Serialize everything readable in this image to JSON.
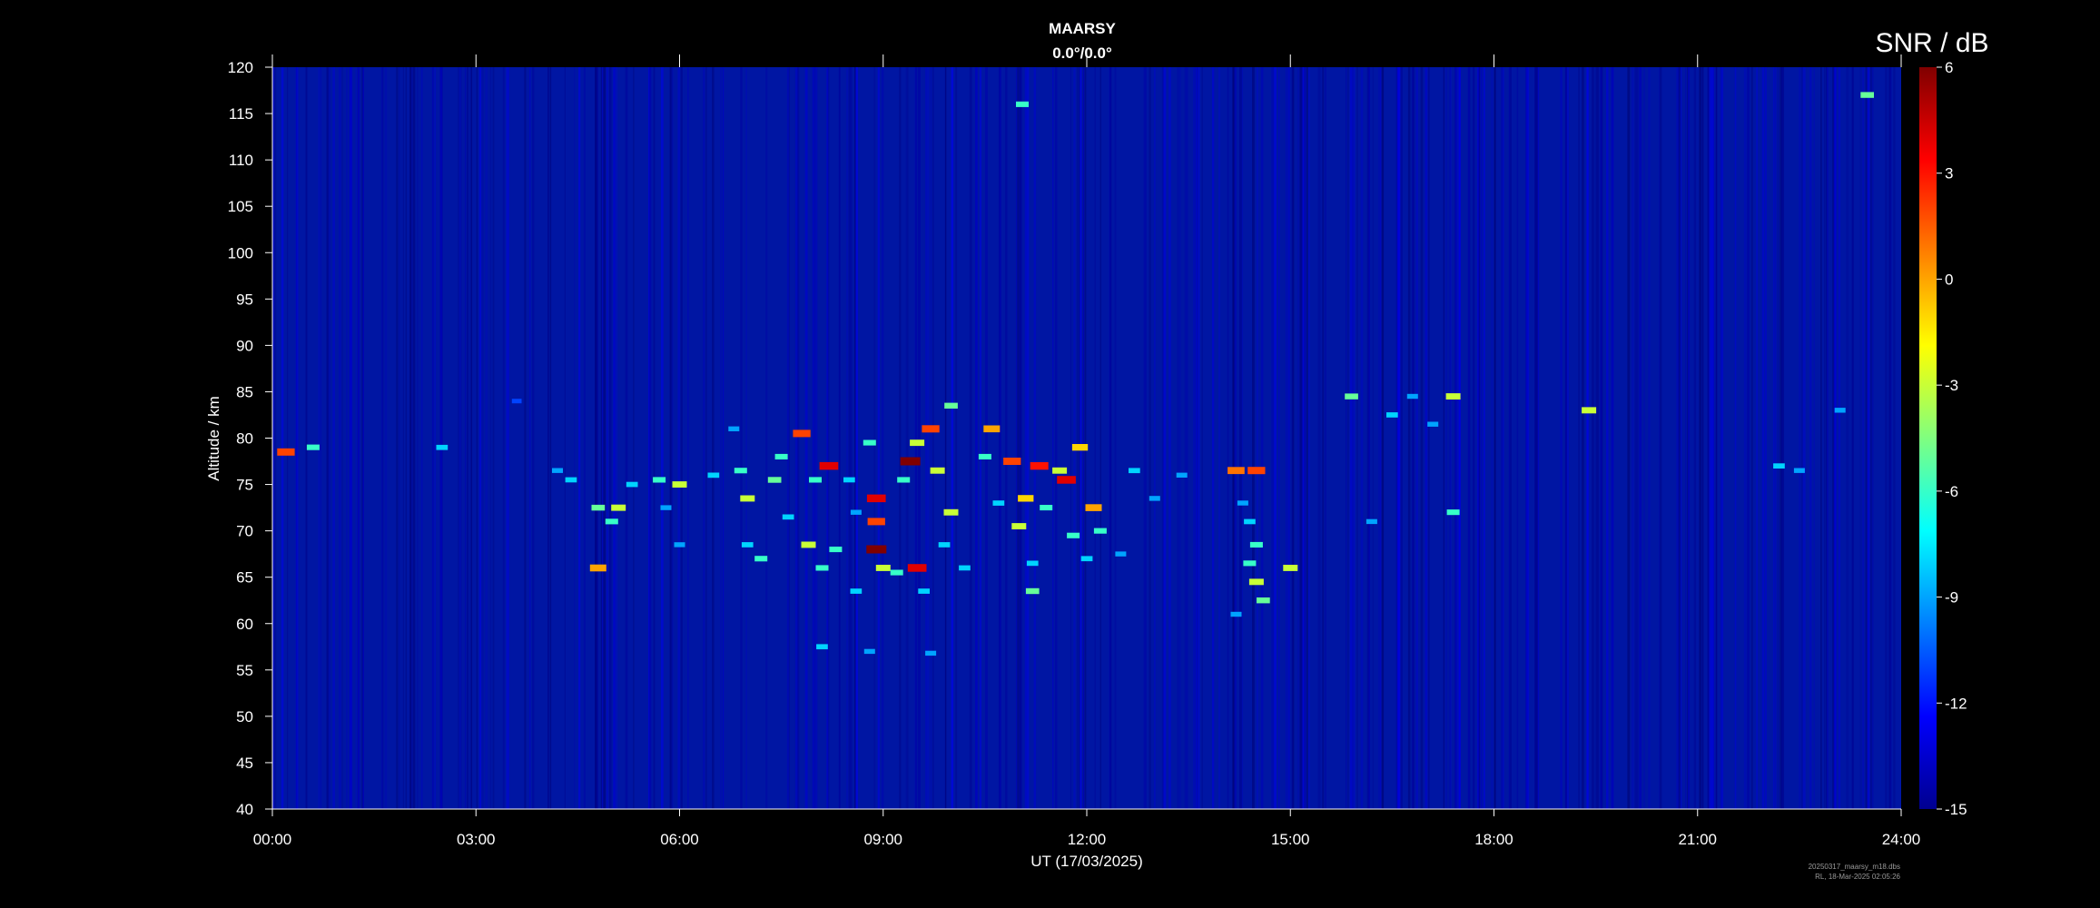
{
  "chart_data": {
    "type": "heatmap",
    "title": "MAARSY",
    "subtitle": "0.0°/0.0°",
    "xlabel": "UT (17/03/2025)",
    "ylabel": "Altitude / km",
    "colorbar_label": "SNR / dB",
    "x_unit": "hours UT",
    "xlim": [
      0,
      24
    ],
    "ylim": [
      40,
      120
    ],
    "x_ticks": [
      0,
      3,
      6,
      9,
      12,
      15,
      18,
      21,
      24
    ],
    "x_tick_labels": [
      "00:00",
      "03:00",
      "06:00",
      "09:00",
      "12:00",
      "15:00",
      "18:00",
      "21:00",
      "24:00"
    ],
    "y_ticks": [
      40,
      45,
      50,
      55,
      60,
      65,
      70,
      75,
      80,
      85,
      90,
      95,
      100,
      105,
      110,
      115,
      120
    ],
    "y_tick_labels": [
      "40",
      "45",
      "50",
      "55",
      "60",
      "65",
      "70",
      "75",
      "80",
      "85",
      "90",
      "95",
      "100",
      "105",
      "110",
      "115",
      "120"
    ],
    "colorbar_range": [
      -15,
      6
    ],
    "colorbar_ticks": [
      -15,
      -12,
      -9,
      -6,
      -3,
      0,
      3,
      6
    ],
    "colorbar_tick_labels": [
      "-15",
      "-12",
      "-9",
      "-6",
      "-3",
      "0",
      "3",
      "6"
    ],
    "colormap": "jet",
    "background_snr": -14,
    "echoes": [
      {
        "t": 0.2,
        "alt": 78.5,
        "snr": 2
      },
      {
        "t": 0.6,
        "alt": 79,
        "snr": -6
      },
      {
        "t": 2.5,
        "alt": 79,
        "snr": -8
      },
      {
        "t": 3.6,
        "alt": 84,
        "snr": -11
      },
      {
        "t": 4.2,
        "alt": 76.5,
        "snr": -9
      },
      {
        "t": 4.4,
        "alt": 75.5,
        "snr": -8
      },
      {
        "t": 4.8,
        "alt": 72.5,
        "snr": -5
      },
      {
        "t": 5.0,
        "alt": 71,
        "snr": -6
      },
      {
        "t": 5.1,
        "alt": 72.5,
        "snr": -3
      },
      {
        "t": 4.8,
        "alt": 66,
        "snr": 0
      },
      {
        "t": 5.3,
        "alt": 75,
        "snr": -8
      },
      {
        "t": 5.7,
        "alt": 75.5,
        "snr": -6
      },
      {
        "t": 6.0,
        "alt": 75,
        "snr": -3
      },
      {
        "t": 5.8,
        "alt": 72.5,
        "snr": -9
      },
      {
        "t": 6.0,
        "alt": 68.5,
        "snr": -9
      },
      {
        "t": 6.5,
        "alt": 76,
        "snr": -8
      },
      {
        "t": 6.8,
        "alt": 81,
        "snr": -9
      },
      {
        "t": 6.9,
        "alt": 76.5,
        "snr": -6
      },
      {
        "t": 7.0,
        "alt": 73.5,
        "snr": -3
      },
      {
        "t": 7.0,
        "alt": 68.5,
        "snr": -8
      },
      {
        "t": 7.2,
        "alt": 67,
        "snr": -6
      },
      {
        "t": 7.4,
        "alt": 75.5,
        "snr": -5
      },
      {
        "t": 7.5,
        "alt": 78,
        "snr": -6
      },
      {
        "t": 7.6,
        "alt": 71.5,
        "snr": -8
      },
      {
        "t": 7.8,
        "alt": 80.5,
        "snr": 2
      },
      {
        "t": 7.9,
        "alt": 68.5,
        "snr": -3
      },
      {
        "t": 8.0,
        "alt": 75.5,
        "snr": -6
      },
      {
        "t": 8.1,
        "alt": 66,
        "snr": -6
      },
      {
        "t": 8.2,
        "alt": 77,
        "snr": 4
      },
      {
        "t": 8.3,
        "alt": 68,
        "snr": -6
      },
      {
        "t": 8.5,
        "alt": 75.5,
        "snr": -8
      },
      {
        "t": 8.6,
        "alt": 63.5,
        "snr": -8
      },
      {
        "t": 8.6,
        "alt": 72,
        "snr": -9
      },
      {
        "t": 8.8,
        "alt": 79.5,
        "snr": -6
      },
      {
        "t": 8.9,
        "alt": 73.5,
        "snr": 4
      },
      {
        "t": 8.9,
        "alt": 71,
        "snr": 2
      },
      {
        "t": 8.9,
        "alt": 68,
        "snr": 6
      },
      {
        "t": 9.0,
        "alt": 66,
        "snr": -3
      },
      {
        "t": 9.2,
        "alt": 65.5,
        "snr": -6
      },
      {
        "t": 9.3,
        "alt": 75.5,
        "snr": -6
      },
      {
        "t": 9.4,
        "alt": 77.5,
        "snr": 6
      },
      {
        "t": 9.5,
        "alt": 79.5,
        "snr": -3
      },
      {
        "t": 9.5,
        "alt": 66,
        "snr": 4
      },
      {
        "t": 9.6,
        "alt": 63.5,
        "snr": -8
      },
      {
        "t": 9.7,
        "alt": 81,
        "snr": 2
      },
      {
        "t": 9.8,
        "alt": 76.5,
        "snr": -3
      },
      {
        "t": 9.9,
        "alt": 68.5,
        "snr": -8
      },
      {
        "t": 10.0,
        "alt": 83.5,
        "snr": -5
      },
      {
        "t": 10.0,
        "alt": 72,
        "snr": -3
      },
      {
        "t": 10.2,
        "alt": 66,
        "snr": -8
      },
      {
        "t": 10.5,
        "alt": 78,
        "snr": -6
      },
      {
        "t": 10.6,
        "alt": 81,
        "snr": 0
      },
      {
        "t": 10.7,
        "alt": 73,
        "snr": -8
      },
      {
        "t": 10.9,
        "alt": 77.5,
        "snr": 2
      },
      {
        "t": 11.0,
        "alt": 70.5,
        "snr": -3
      },
      {
        "t": 11.1,
        "alt": 73.5,
        "snr": -1
      },
      {
        "t": 11.2,
        "alt": 66.5,
        "snr": -8
      },
      {
        "t": 11.2,
        "alt": 63.5,
        "snr": -5
      },
      {
        "t": 11.3,
        "alt": 77,
        "snr": 3
      },
      {
        "t": 11.4,
        "alt": 72.5,
        "snr": -6
      },
      {
        "t": 11.6,
        "alt": 76.5,
        "snr": -3
      },
      {
        "t": 11.7,
        "alt": 75.5,
        "snr": 4
      },
      {
        "t": 11.8,
        "alt": 69.5,
        "snr": -6
      },
      {
        "t": 11.9,
        "alt": 79,
        "snr": -1
      },
      {
        "t": 12.0,
        "alt": 67,
        "snr": -8
      },
      {
        "t": 12.1,
        "alt": 72.5,
        "snr": 0
      },
      {
        "t": 12.2,
        "alt": 70,
        "snr": -6
      },
      {
        "t": 12.5,
        "alt": 67.5,
        "snr": -9
      },
      {
        "t": 12.7,
        "alt": 76.5,
        "snr": -8
      },
      {
        "t": 13.0,
        "alt": 73.5,
        "snr": -9
      },
      {
        "t": 13.4,
        "alt": 76,
        "snr": -9
      },
      {
        "t": 14.2,
        "alt": 76.5,
        "snr": 1
      },
      {
        "t": 14.5,
        "alt": 76.5,
        "snr": 2
      },
      {
        "t": 14.3,
        "alt": 73,
        "snr": -9
      },
      {
        "t": 14.4,
        "alt": 71,
        "snr": -8
      },
      {
        "t": 14.5,
        "alt": 68.5,
        "snr": -6
      },
      {
        "t": 14.4,
        "alt": 66.5,
        "snr": -6
      },
      {
        "t": 14.5,
        "alt": 64.5,
        "snr": -3
      },
      {
        "t": 14.6,
        "alt": 62.5,
        "snr": -5
      },
      {
        "t": 14.2,
        "alt": 61,
        "snr": -9
      },
      {
        "t": 15.0,
        "alt": 66,
        "snr": -3
      },
      {
        "t": 15.9,
        "alt": 84.5,
        "snr": -5
      },
      {
        "t": 16.5,
        "alt": 82.5,
        "snr": -8
      },
      {
        "t": 16.8,
        "alt": 84.5,
        "snr": -9
      },
      {
        "t": 17.1,
        "alt": 81.5,
        "snr": -9
      },
      {
        "t": 17.4,
        "alt": 84.5,
        "snr": -3
      },
      {
        "t": 17.4,
        "alt": 72,
        "snr": -6
      },
      {
        "t": 16.2,
        "alt": 71,
        "snr": -9
      },
      {
        "t": 19.4,
        "alt": 83,
        "snr": -3
      },
      {
        "t": 22.2,
        "alt": 77,
        "snr": -8
      },
      {
        "t": 22.5,
        "alt": 76.5,
        "snr": -9
      },
      {
        "t": 23.1,
        "alt": 83,
        "snr": -9
      },
      {
        "t": 11.05,
        "alt": 116,
        "snr": -6
      },
      {
        "t": 23.5,
        "alt": 117,
        "snr": -5
      },
      {
        "t": 8.1,
        "alt": 57.5,
        "snr": -8
      },
      {
        "t": 8.8,
        "alt": 57,
        "snr": -9
      },
      {
        "t": 9.7,
        "alt": 56.8,
        "snr": -9
      }
    ]
  },
  "footer": {
    "file_line": "20250317_maarsy_m18.dbs",
    "author_line": "RL, 18-Mar-2025 02:05:26"
  }
}
